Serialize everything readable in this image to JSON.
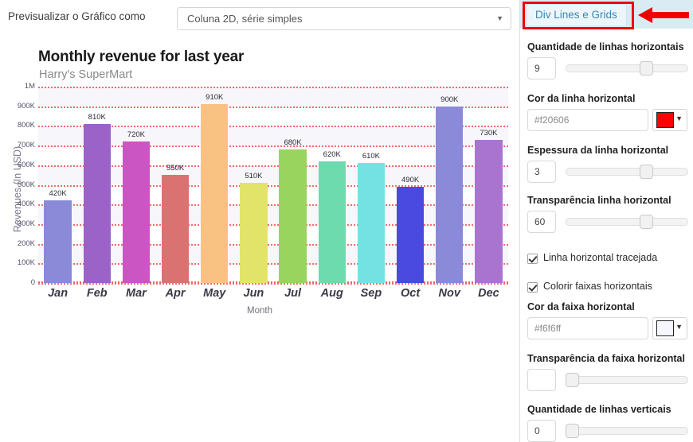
{
  "toolbar": {
    "preview_label": "Previsualizar o Gráfico como",
    "chart_type_value": "Coluna 2D, série simples",
    "caret_icon": "chevron-down-icon"
  },
  "panel": {
    "tab_label": "Div Lines e Grids",
    "fields": {
      "h_lines_count_label": "Quantidade de linhas horizontais",
      "h_lines_count_value": "9",
      "h_line_color_label": "Cor da linha horizontal",
      "h_line_color_value": "#f20606",
      "h_line_color_swatch": "#fe0000",
      "h_line_thickness_label": "Espessura da linha horizontal",
      "h_line_thickness_value": "3",
      "h_line_alpha_label": "Transparência linha horizontal",
      "h_line_alpha_value": "60",
      "dashed_label": "Linha horizontal tracejada",
      "dashed_checked": true,
      "color_bands_label": "Colorir faixas horizontais",
      "color_bands_checked": true,
      "band_color_label": "Cor da faixa horizontal",
      "band_color_value": "#f6f6ff",
      "band_color_swatch": "#f6f6ff",
      "band_alpha_label": "Transparência da faixa horizontal",
      "band_alpha_value": "",
      "v_lines_count_label": "Quantidade de linhas verticais",
      "v_lines_count_value": "0"
    }
  },
  "chart_data": {
    "type": "bar",
    "title": "Monthly revenue for last year",
    "subtitle": "Harry's SuperMart",
    "xlabel": "Month",
    "ylabel": "Revenues (In USD)",
    "categories": [
      "Jan",
      "Feb",
      "Mar",
      "Apr",
      "May",
      "Jun",
      "Jul",
      "Aug",
      "Sep",
      "Oct",
      "Nov",
      "Dec"
    ],
    "values": [
      420000,
      810000,
      720000,
      550000,
      910000,
      510000,
      680000,
      620000,
      610000,
      490000,
      900000,
      730000
    ],
    "value_labels": [
      "420K",
      "810K",
      "720K",
      "550K",
      "910K",
      "510K",
      "680K",
      "620K",
      "610K",
      "490K",
      "900K",
      "730K"
    ],
    "colors": [
      "#8a8ad8",
      "#9b63c8",
      "#cc55c4",
      "#db7272",
      "#fac282",
      "#e2e369",
      "#99d45e",
      "#6ddbae",
      "#74e2e2",
      "#4a4ae0",
      "#8a8ad8",
      "#a974cf"
    ],
    "ylim": [
      0,
      1000000
    ],
    "ytick_labels": [
      "0",
      "100K",
      "200K",
      "300K",
      "400K",
      "500K",
      "600K",
      "700K",
      "800K",
      "900K",
      "1M"
    ],
    "ytick_values": [
      0,
      100000,
      200000,
      300000,
      400000,
      500000,
      600000,
      700000,
      800000,
      900000,
      1000000
    ],
    "gridline_color": "#f25f5f",
    "gridline_dashed": true,
    "band_color": "#f7f6fb",
    "grid": true,
    "legend": "none"
  }
}
